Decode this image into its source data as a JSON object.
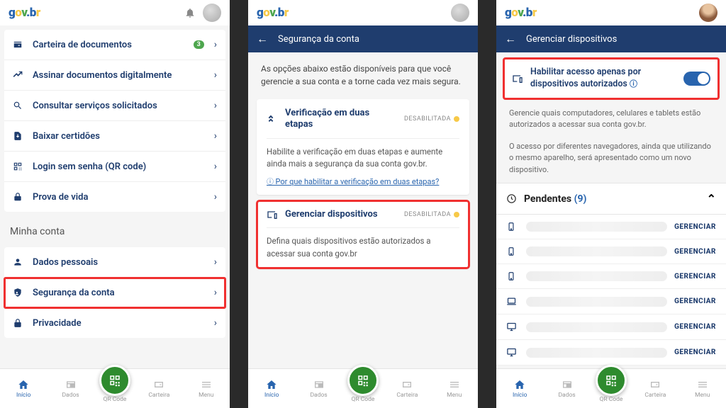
{
  "logo": {
    "g": "g",
    "o": "o",
    "v": "v",
    "dot": ".",
    "b": "b",
    "r": "r"
  },
  "screen1": {
    "items": [
      {
        "icon": "wallet",
        "label": "Carteira de documentos",
        "badge": "3"
      },
      {
        "icon": "sign",
        "label": "Assinar documentos digitalmente"
      },
      {
        "icon": "search",
        "label": "Consultar serviços solicitados"
      },
      {
        "icon": "download",
        "label": "Baixar certidões"
      },
      {
        "icon": "qr",
        "label": "Login sem senha (QR code)"
      },
      {
        "icon": "proof",
        "label": "Prova de vida"
      }
    ],
    "section": "Minha conta",
    "account_items": [
      {
        "icon": "person",
        "label": "Dados pessoais"
      },
      {
        "icon": "shield",
        "label": "Segurança da conta",
        "highlight": true
      },
      {
        "icon": "lock",
        "label": "Privacidade"
      }
    ]
  },
  "screen2": {
    "title": "Segurança da conta",
    "intro": "As opções abaixo estão disponíveis para que você gerencie a sua conta e a torne cada vez mais segura.",
    "card1": {
      "title": "Verificação em duas etapas",
      "status": "DESABILITADA",
      "body": "Habilite a verificação em duas etapas e aumente ainda mais a segurança da sua conta gov.br.",
      "link": "Por que habilitar a verificação em duas etapas?"
    },
    "card2": {
      "title": "Gerenciar dispositivos",
      "status": "DESABILITADA",
      "body": "Defina quais dispositivos estão autorizados a acessar sua conta gov.br"
    }
  },
  "screen3": {
    "title": "Gerenciar dispositivos",
    "toggle_label": "Habilitar acesso apenas por dispositivos autorizados",
    "desc1": "Gerencie quais computadores, celulares e tablets estão autorizados a acessar sua conta gov.br.",
    "desc2": "O acesso por diferentes navegadores, ainda que utilizando o mesmo aparelho, será apresentado como um novo dispositivo.",
    "pending_label": "Pendentes",
    "pending_count": "(9)",
    "manage": "GERENCIAR",
    "devices": [
      "phone",
      "phone",
      "phone",
      "laptop",
      "monitor",
      "monitor"
    ]
  },
  "nav": {
    "inicio": "Início",
    "dados": "Dados",
    "qr": "QR Code",
    "carteira": "Carteira",
    "menu": "Menu"
  }
}
